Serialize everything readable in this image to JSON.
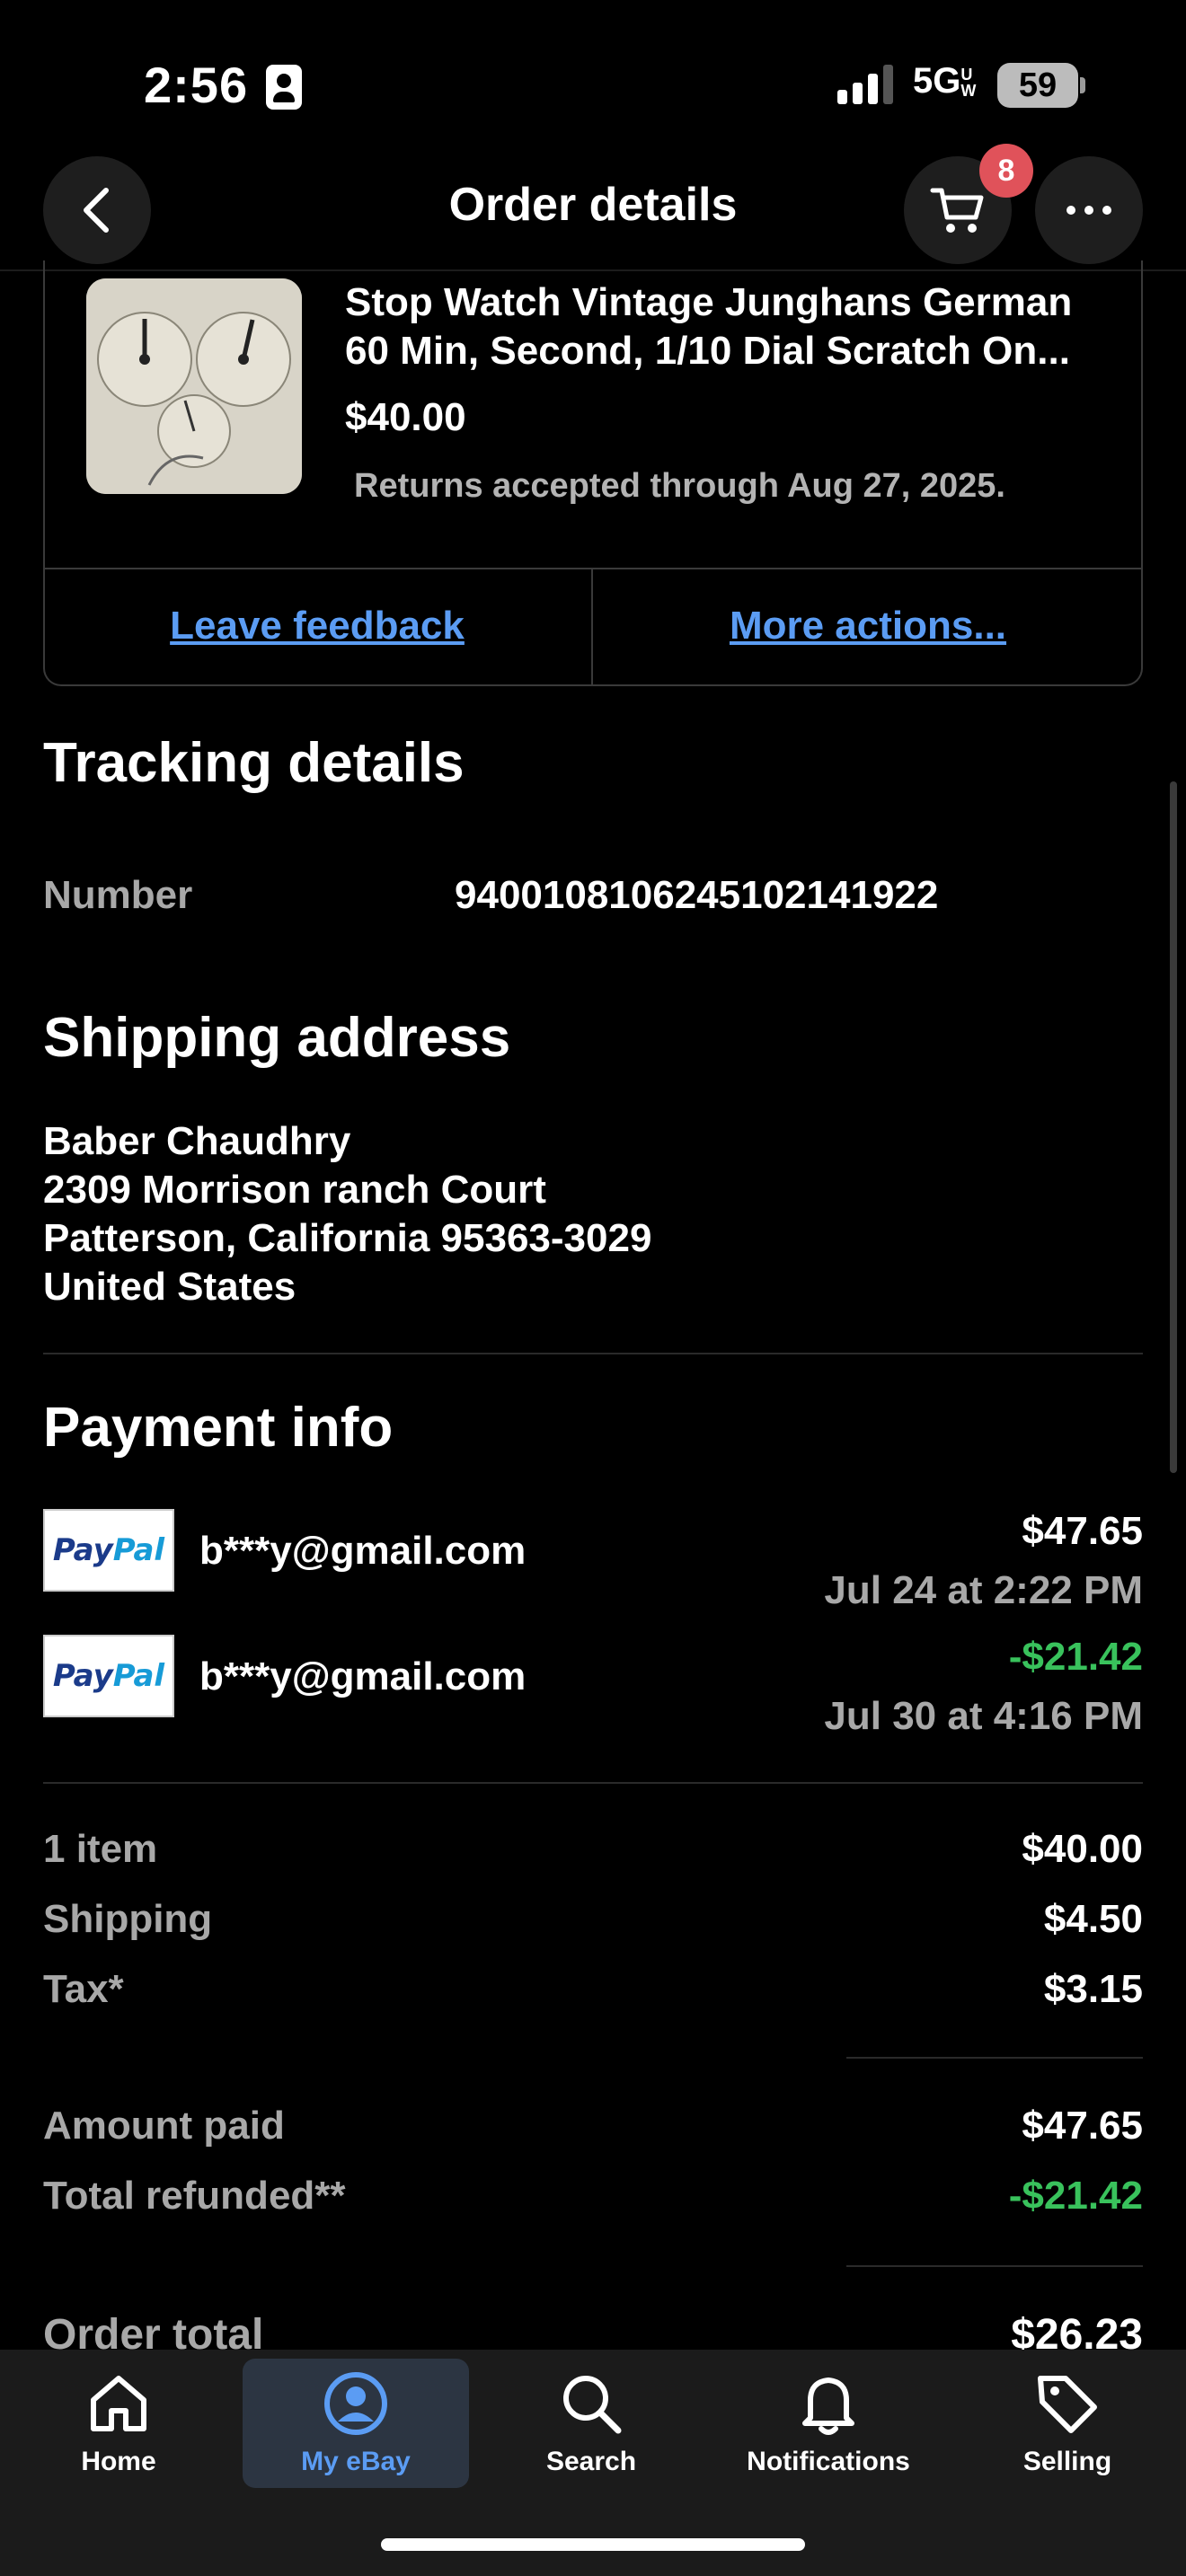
{
  "status_bar": {
    "time": "2:56",
    "network": "5G",
    "network_suffix": "UW",
    "battery": "59"
  },
  "header": {
    "title": "Order details",
    "cart_count": "8"
  },
  "item": {
    "title_line1": "Stop Watch Vintage Junghans German",
    "title_line2": "60 Min, Second, 1/10 Dial Scratch On...",
    "price": "$40.00",
    "returns": "Returns accepted through Aug 27, 2025.",
    "leave_feedback": "Leave feedback",
    "more_actions": "More actions..."
  },
  "tracking": {
    "heading": "Tracking details",
    "number_label": "Number",
    "number_value": "9400108106245102141922"
  },
  "shipping": {
    "heading": "Shipping address",
    "name": "Baber Chaudhry",
    "street": "2309 Morrison ranch Court",
    "city": "Patterson, California 95363-3029",
    "country": "United States"
  },
  "payment": {
    "heading": "Payment info",
    "entries": [
      {
        "method": "PayPal",
        "email": "b***y@gmail.com",
        "amount": "$47.65",
        "date": "Jul 24 at 2:22 PM"
      },
      {
        "method": "PayPal",
        "email": "b***y@gmail.com",
        "amount": "-$21.42",
        "date": "Jul 30 at 4:16 PM"
      }
    ]
  },
  "summary": {
    "rows": [
      {
        "label": "1 item",
        "value": "$40.00"
      },
      {
        "label": "Shipping",
        "value": "$4.50"
      },
      {
        "label": "Tax*",
        "value": "$3.15"
      }
    ],
    "amount_paid_label": "Amount paid",
    "amount_paid": "$47.65",
    "refunded_label": "Total refunded**",
    "refunded": "-$21.42",
    "order_total_label": "Order total",
    "order_total": "$26.23"
  },
  "tab_bar": {
    "tabs": [
      {
        "label": "Home",
        "icon": "home-icon"
      },
      {
        "label": "My eBay",
        "icon": "profile-icon"
      },
      {
        "label": "Search",
        "icon": "search-icon"
      },
      {
        "label": "Notifications",
        "icon": "bell-icon"
      },
      {
        "label": "Selling",
        "icon": "tag-icon"
      }
    ],
    "active": "My eBay"
  },
  "colors": {
    "link": "#5b9cf3",
    "refund": "#39c25c",
    "badge": "#e0525a"
  }
}
